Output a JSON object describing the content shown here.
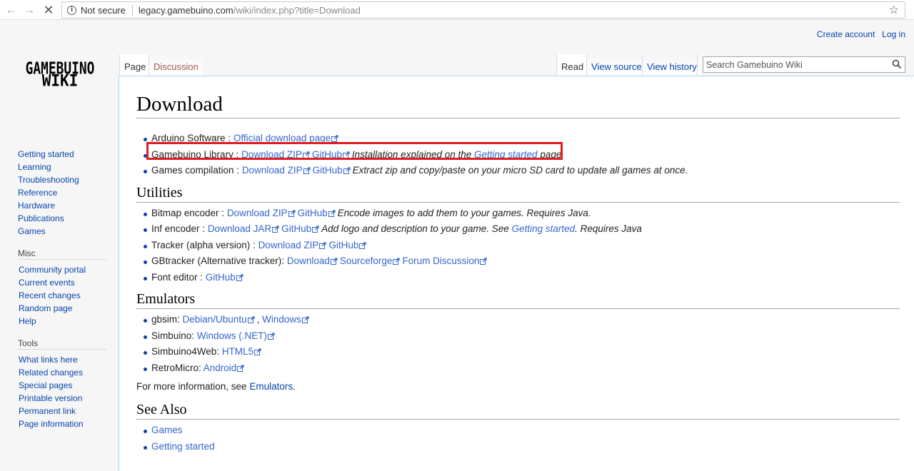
{
  "browser": {
    "security": "Not secure",
    "url_host": "legacy.gamebuino.com",
    "url_path": "/wiki/index.php?title=Download"
  },
  "personal": {
    "create_account": "Create account",
    "login": "Log in"
  },
  "logo": {
    "line1": "GAMEBUINO",
    "line2": "WIKI"
  },
  "tabs": {
    "page": "Page",
    "discussion": "Discussion",
    "read": "Read",
    "view_source": "View source",
    "view_history": "View history"
  },
  "search": {
    "placeholder": "Search Gamebuino Wiki"
  },
  "sidebar": {
    "navigation": [
      "Getting started",
      "Learning",
      "Troubleshooting",
      "Reference",
      "Hardware",
      "Publications",
      "Games"
    ],
    "misc_title": "Misc",
    "misc": [
      "Community portal",
      "Current events",
      "Recent changes",
      "Random page",
      "Help"
    ],
    "tools_title": "Tools",
    "tools": [
      "What links here",
      "Related changes",
      "Special pages",
      "Printable version",
      "Permanent link",
      "Page information"
    ]
  },
  "content": {
    "title": "Download",
    "downloads": [
      {
        "label": "Arduino Software : ",
        "links": [
          "Official download page"
        ],
        "note": ""
      },
      {
        "label": "Gamebuino Library : ",
        "links": [
          "Download ZIP",
          "GitHub"
        ],
        "note_pre": "Installation explained on the ",
        "note_link": "Getting started",
        "note_post": " page"
      },
      {
        "label": "Games compilation : ",
        "links": [
          "Download ZIP",
          "GitHub"
        ],
        "note": "Extract zip and copy/paste on your micro SD card to update all games at once."
      }
    ],
    "utilities_heading": "Utilities",
    "utilities": [
      {
        "label": "Bitmap encoder : ",
        "links": [
          "Download ZIP",
          "GitHub"
        ],
        "note": "Encode images to add them to your games. Requires Java."
      },
      {
        "label": "Inf encoder : ",
        "links": [
          "Download JAR",
          "GitHub"
        ],
        "note_pre": "Add logo and description to your game. See ",
        "note_link": "Getting started",
        "note_post": ". Requires Java"
      },
      {
        "label": "Tracker (alpha version) : ",
        "links": [
          "Download ZIP",
          "GitHub"
        ],
        "note": ""
      },
      {
        "label": "GBtracker (Alternative tracker): ",
        "links": [
          "Download",
          "Sourceforge",
          "Forum Discussion"
        ],
        "note": ""
      },
      {
        "label": "Font editor : ",
        "links": [
          "GitHub"
        ],
        "note": ""
      }
    ],
    "emulators_heading": "Emulators",
    "emulators": [
      {
        "label": "gbsim: ",
        "links": [
          "Debian/Ubuntu",
          "Windows"
        ],
        "sep": ", "
      },
      {
        "label": "Simbuino: ",
        "links": [
          "Windows (.NET)"
        ]
      },
      {
        "label": "Simbuino4Web: ",
        "links": [
          "HTML5"
        ]
      },
      {
        "label": "RetroMicro: ",
        "links": [
          "Android"
        ]
      }
    ],
    "more_pre": "For more information, see ",
    "more_link": "Emulators",
    "more_post": ".",
    "see_also_heading": "See Also",
    "see_also": [
      "Games",
      "Getting started"
    ]
  }
}
